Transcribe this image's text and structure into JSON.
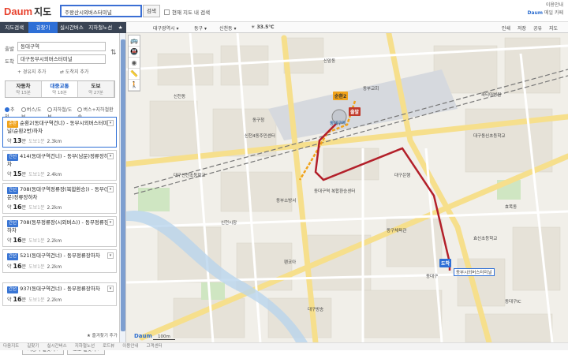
{
  "header": {
    "logo_brand": "Daum",
    "logo_service": "지도",
    "search_value": "주왕산시외버스터미널",
    "search_button": "검색",
    "in_map_checkbox": "현재 지도 내 검색",
    "top_links": [
      "이용안내",
      "Daum",
      "메일",
      "카페"
    ]
  },
  "nav": {
    "tabs": [
      "지도검색",
      "길찾기",
      "실시간버스",
      "지하철노선",
      "★"
    ],
    "active_index": 1
  },
  "route": {
    "origin_label": "출발",
    "origin_value": "동대구역",
    "dest_label": "도착",
    "dest_value": "대구동부시외버스터미널",
    "add_waypoint": "+ 경유지 추가",
    "reverse": "⇄ 도착지 추가",
    "modes": [
      {
        "label": "자동차",
        "time": "약 15분"
      },
      {
        "label": "대중교통",
        "time": "약 18분"
      },
      {
        "label": "도보",
        "time": "약 27분"
      }
    ],
    "active_mode": 1,
    "filters": [
      "추천",
      "버스/도보",
      "지하철/도보",
      "버스+지하철환승"
    ]
  },
  "results": [
    {
      "tag": "순환",
      "tag_orange": true,
      "title": "순환2(동대구역건너) - 동부시외버스터미널(순환2번)하차",
      "time": "13",
      "detail": "도보1분",
      "dist": "2.3km"
    },
    {
      "tag": "간선",
      "tag_orange": false,
      "title": "414(동대구역건너) - 동부(남문)정류장하차",
      "time": "15",
      "detail": "도보1분",
      "dist": "2.4km"
    },
    {
      "tag": "간선",
      "tag_orange": false,
      "title": "708(동대구역정류장(복합환승)) - 동부(남문)정류장하차",
      "time": "16",
      "detail": "도보1분",
      "dist": "2.2km"
    },
    {
      "tag": "간선",
      "tag_orange": false,
      "title": "708(동부정류장(시외버스)) - 동부정류장하차",
      "time": "16",
      "detail": "도보1분",
      "dist": "2.2km"
    },
    {
      "tag": "간선",
      "tag_orange": false,
      "title": "521(동대구역건너) - 동부정류장하차",
      "time": "16",
      "detail": "도보1분",
      "dist": "2.2km"
    },
    {
      "tag": "간선",
      "tag_orange": false,
      "title": "937(동대구역건너) - 동부정류장하차",
      "time": "16",
      "detail": "도보1분",
      "dist": "2.2km"
    }
  ],
  "time_prefix": "약",
  "time_unit": "분",
  "buttons": {
    "car": "자동차 길찾기 ›",
    "walk": "도보 길찾기 ›"
  },
  "favorites": "★ 즐겨찾기 추가",
  "footer": [
    "다음지도",
    "길찾기",
    "실시간버스",
    "지하철노선",
    "로드뷰",
    "이용안내",
    "고객센터"
  ],
  "mapbar": {
    "region": "대구광역시 ▾",
    "district": "동구 ▾",
    "dong": "신천동 ▾",
    "weather": "☀ 33.5℃",
    "right_links": [
      "인쇄",
      "저장",
      "공유",
      "지도"
    ]
  },
  "map_labels": [
    "동대구역",
    "순환2",
    "동부시외버스터미널",
    "동대구",
    "신천동",
    "신암동",
    "효목동",
    "동구청",
    "대구신천초등학교",
    "신천4동주민센터",
    "동부소방서",
    "대구동신초등학교",
    "동대구역 복합환승센터",
    "파티마병원",
    "동구체육관",
    "신천시장",
    "효신초등학교",
    "대구방송",
    "대구은행",
    "팬코아",
    "동부교회",
    "동대구IC"
  ],
  "markers": {
    "start": "출발",
    "end": "도착"
  },
  "scale": "100m",
  "colors": {
    "accent": "#2e6fd6",
    "route": "#b3202a",
    "nav_bg": "#3a4454"
  }
}
